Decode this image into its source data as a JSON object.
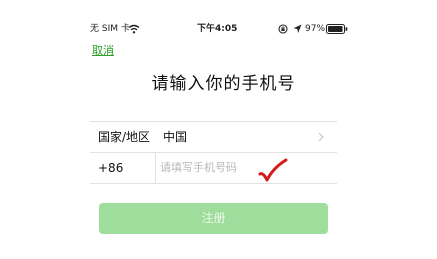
{
  "status_bar": {
    "carrier": "无 SIM 卡",
    "time": "下午4:05",
    "battery_percent": "97%",
    "battery_level": 0.97,
    "icons": [
      "wifi-icon",
      "rotation-lock-icon",
      "location-icon",
      "battery-icon"
    ]
  },
  "nav": {
    "cancel_label": "取消"
  },
  "title": "请输入你的手机号",
  "form": {
    "region_label": "国家/地区",
    "region_value": "中国",
    "country_code": "+86",
    "phone_placeholder": "请填写手机号码",
    "phone_value": ""
  },
  "register_label": "注册",
  "colors": {
    "accent": "#2aa024",
    "button_disabled": "#9fdd9c",
    "check_mark": "#d61a1a"
  }
}
